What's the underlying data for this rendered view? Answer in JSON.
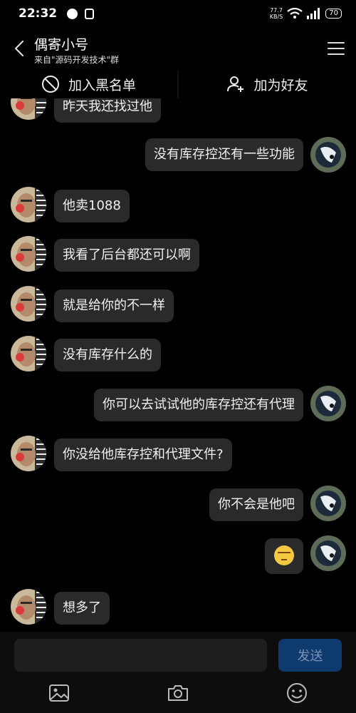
{
  "status_bar": {
    "time": "22:32",
    "net_speed_value": "77.7",
    "net_speed_unit": "KB/S",
    "battery": "70"
  },
  "header": {
    "title": "偶寄小号",
    "subtitle": "来自\"源码开发技术\"群"
  },
  "actions": {
    "block_label": "加入黑名单",
    "add_friend_label": "加为好友"
  },
  "messages": [
    {
      "side": "left",
      "text": "昨天我还找过他"
    },
    {
      "side": "right",
      "text": "没有库存控还有一些功能"
    },
    {
      "side": "left",
      "text": "他卖1088"
    },
    {
      "side": "left",
      "text": "我看了后台都还可以啊"
    },
    {
      "side": "left",
      "text": "就是给你的不一样"
    },
    {
      "side": "left",
      "text": "没有库存什么的"
    },
    {
      "side": "right",
      "text": "你可以去试试他的库存控还有代理"
    },
    {
      "side": "left",
      "text": "你没给他库存控和代理文件?"
    },
    {
      "side": "right",
      "text": "你不会是他吧"
    },
    {
      "side": "right",
      "emoji": "smirk-face-emoji"
    },
    {
      "side": "left",
      "text": "想多了"
    }
  ],
  "composer": {
    "input_value": "",
    "send_label": "发送"
  },
  "toolbar_icons": [
    "image-icon",
    "camera-icon",
    "emoji-icon"
  ]
}
